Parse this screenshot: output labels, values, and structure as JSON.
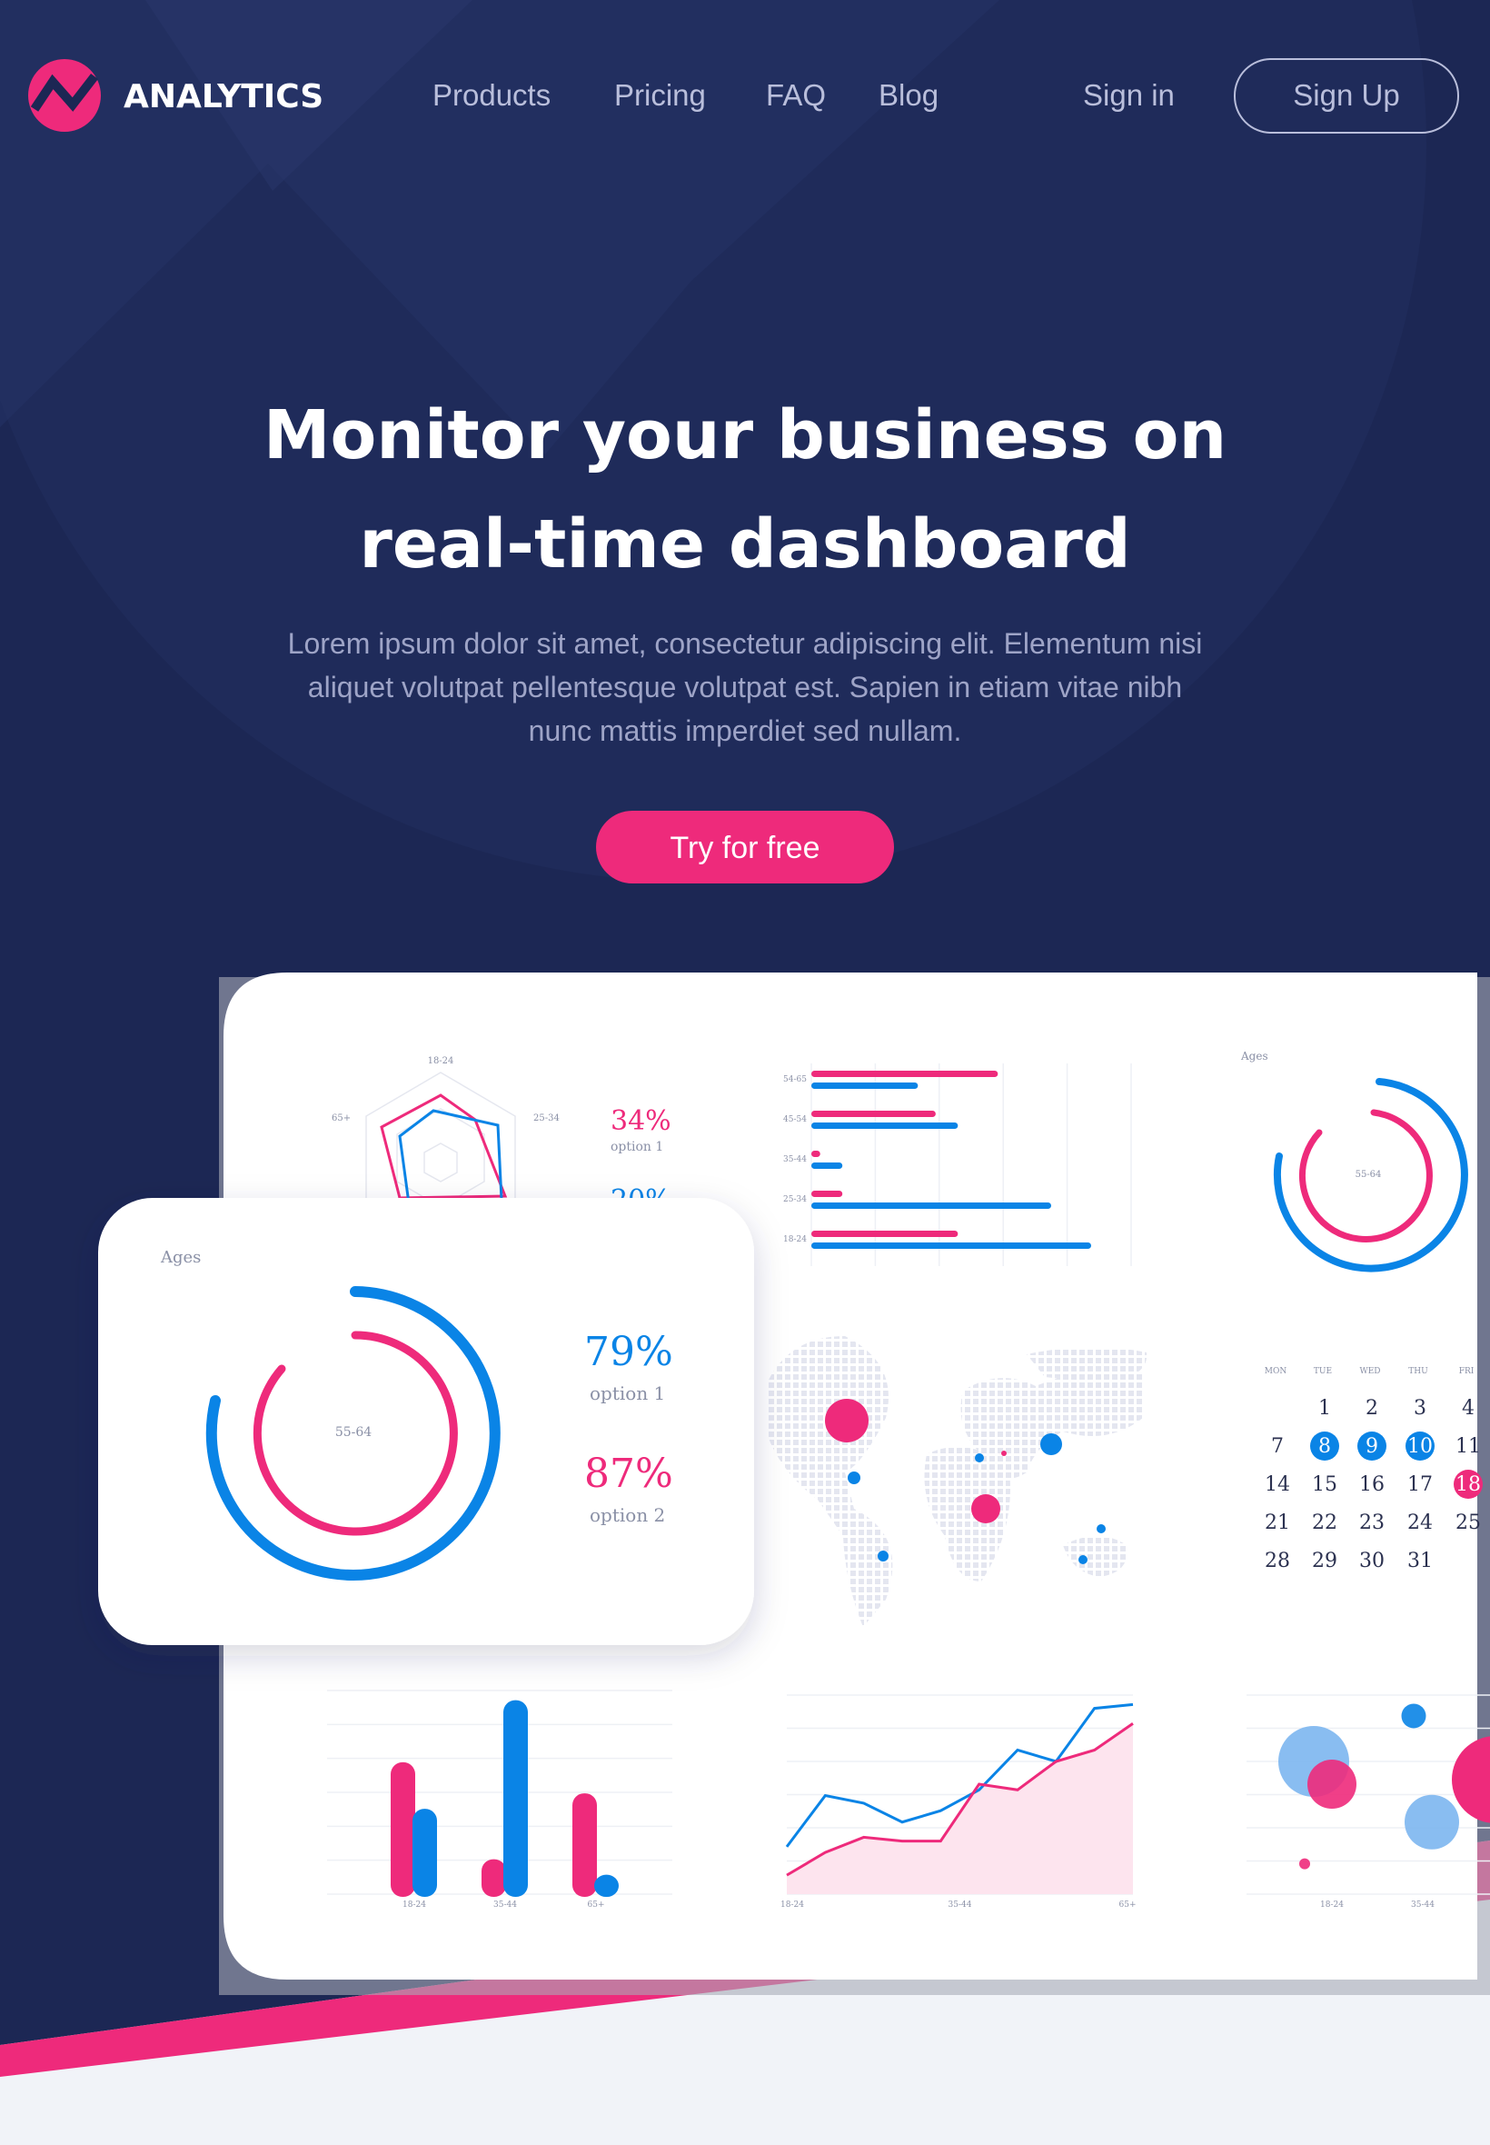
{
  "brand": {
    "name": "ANALYTICS",
    "logo_icon": "trend-line-logo",
    "accent": "#ee2a7b"
  },
  "colors": {
    "navy": "#1c2754",
    "pink": "#ee2a7b",
    "blue": "#0a84e6",
    "light": "#f1f3f8"
  },
  "nav": {
    "links": [
      "Products",
      "Pricing",
      "FAQ",
      "Blog"
    ],
    "sign_in": "Sign in",
    "sign_up": "Sign Up"
  },
  "hero": {
    "title_line1": "Monitor your business on",
    "title_line2": "real-time dashboard",
    "subtitle_line1": "Lorem ipsum dolor sit amet, consectetur adipiscing elit. Elementum nisi",
    "subtitle_line2": "aliquet volutpat pellentesque volutpat est. Sapien in etiam vitae nibh",
    "subtitle_line3": "nunc mattis imperdiet sed nullam.",
    "cta": "Try for free"
  },
  "dashboard": {
    "radar": {
      "labels": [
        "18-24",
        "25-34",
        "65+"
      ],
      "stat1_value": "34%",
      "stat1_label": "option 1",
      "stat2_value": "20%"
    },
    "floating_card": {
      "title": "Ages",
      "center_label": "55-64",
      "stat1_value": "79%",
      "stat1_label": "option 1",
      "stat2_value": "87%",
      "stat2_label": "option 2"
    },
    "ring_small": {
      "title": "Ages",
      "center_label": "55-64"
    },
    "calendar": {
      "days": [
        "MON",
        "TUE",
        "WED",
        "THU",
        "FRI"
      ],
      "rows": [
        [
          "",
          "1",
          "2",
          "3",
          "4"
        ],
        [
          "7",
          "8",
          "9",
          "10",
          "11"
        ],
        [
          "14",
          "15",
          "16",
          "17",
          "18"
        ],
        [
          "21",
          "22",
          "23",
          "24",
          "25"
        ],
        [
          "28",
          "29",
          "30",
          "31",
          ""
        ]
      ],
      "highlighted_blue": [
        "8",
        "9",
        "10"
      ],
      "highlighted_pink": [
        "18"
      ]
    }
  },
  "chart_data": [
    {
      "type": "bar",
      "orientation": "horizontal",
      "categories": [
        "54-65",
        "45-54",
        "35-44",
        "25-34",
        "18-24"
      ],
      "series": [
        {
          "color": "#ee2a7b",
          "values": [
            42,
            28,
            2,
            7,
            33
          ]
        },
        {
          "color": "#0a84e6",
          "values": [
            24,
            33,
            7,
            54,
            63
          ]
        }
      ],
      "xlim": [
        0,
        72
      ]
    },
    {
      "type": "bar",
      "categories": [
        "18-24",
        "",
        "35-44",
        "",
        "65+"
      ],
      "series": [
        {
          "color": "#ee2a7b",
          "values": [
            68,
            null,
            18,
            null,
            52
          ]
        },
        {
          "color": "#0a84e6",
          "values": [
            44,
            null,
            100,
            null,
            10
          ]
        }
      ],
      "ylim": [
        0,
        105
      ]
    },
    {
      "type": "area",
      "x_tick_labels": [
        "18-24",
        "35-44",
        "65+"
      ],
      "series": [
        {
          "color": "#0a84e6",
          "values": [
            25,
            52,
            48,
            38,
            44,
            55,
            76,
            70,
            98,
            100
          ]
        },
        {
          "color": "#ee2a7b",
          "values": [
            10,
            22,
            30,
            28,
            28,
            58,
            55,
            70,
            76,
            90
          ]
        }
      ],
      "ylim": [
        0,
        105
      ]
    },
    {
      "type": "scatter",
      "x_tick_labels": [
        "18-24",
        "35-44"
      ],
      "points": [
        {
          "x": 1,
          "y": 70,
          "r": 26,
          "color": "#7cb6ef"
        },
        {
          "x": 1.4,
          "y": 58,
          "r": 18,
          "color": "#ee2a7b"
        },
        {
          "x": 3.2,
          "y": 94,
          "r": 9,
          "color": "#0a84e6"
        },
        {
          "x": 3.6,
          "y": 38,
          "r": 20,
          "color": "#7cb6ef"
        },
        {
          "x": 0.8,
          "y": 16,
          "r": 4,
          "color": "#ee2a7b"
        }
      ]
    }
  ]
}
